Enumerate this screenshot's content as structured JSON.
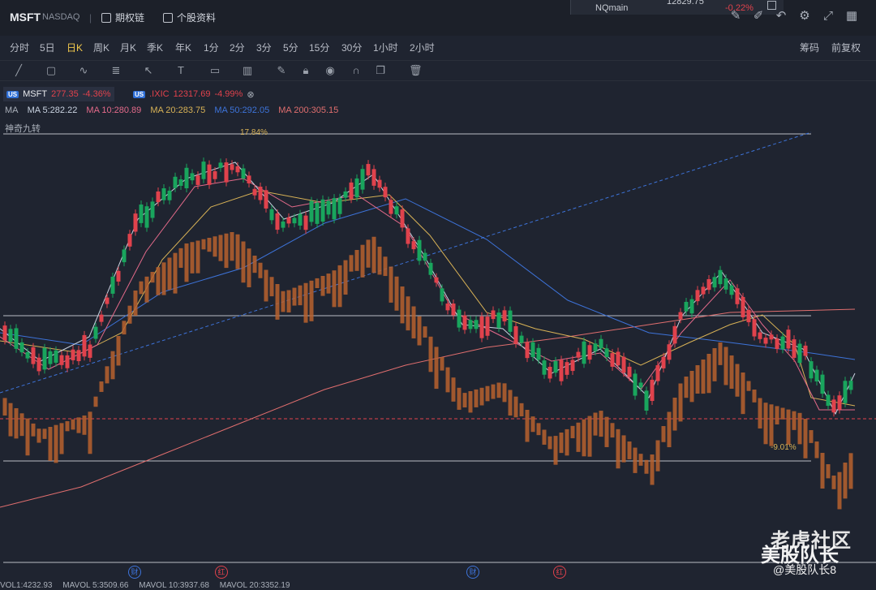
{
  "header": {
    "ticker": "MSFT",
    "exchange": "NASDAQ",
    "separator": "|",
    "options_label": "期权链",
    "profile_label": "个股资料",
    "quote_name": "NQmain",
    "quote_price": "12829.75",
    "quote_change": "-0.22%"
  },
  "periods": [
    "分时",
    "5日",
    "日K",
    "周K",
    "月K",
    "季K",
    "年K",
    "1分",
    "2分",
    "3分",
    "5分",
    "15分",
    "30分",
    "1小时",
    "2小时"
  ],
  "active_period": "日K",
  "right_options": {
    "chips": "筹码",
    "adjust": "前复权"
  },
  "tabs": [
    {
      "code": "US",
      "name": "MSFT",
      "price": "277.35",
      "change": "-4.36%"
    },
    {
      "code": "US",
      "name": ".IXIC",
      "price": "12317.69",
      "change": "-4.99%"
    }
  ],
  "ma": {
    "label": "MA",
    "ma5": "MA  5:282.22",
    "ma10": "MA  10:280.89",
    "ma20": "MA  20:283.75",
    "ma50": "MA  50:292.05",
    "ma200": "MA  200:305.15"
  },
  "indicator": "神奇九转",
  "annotations": {
    "high_pct": "17.84%",
    "low_pct": "-9.01%"
  },
  "events": [
    "财",
    "红",
    "财",
    "红"
  ],
  "volume": {
    "vol": "VOL1:4232.93",
    "mavol1": "MAVOL 5:3509.66",
    "mavol2": "MAVOL 10:3937.68",
    "mavol3": "MAVOL 20:3352.19"
  },
  "watermark": {
    "line1": "老虎社区",
    "line2": "美股队长",
    "line3": "@美股队长8"
  },
  "colors": {
    "up": "#19a55d",
    "down": "#e0424c",
    "background": "#1f2430",
    "accent": "#f2c94c"
  }
}
